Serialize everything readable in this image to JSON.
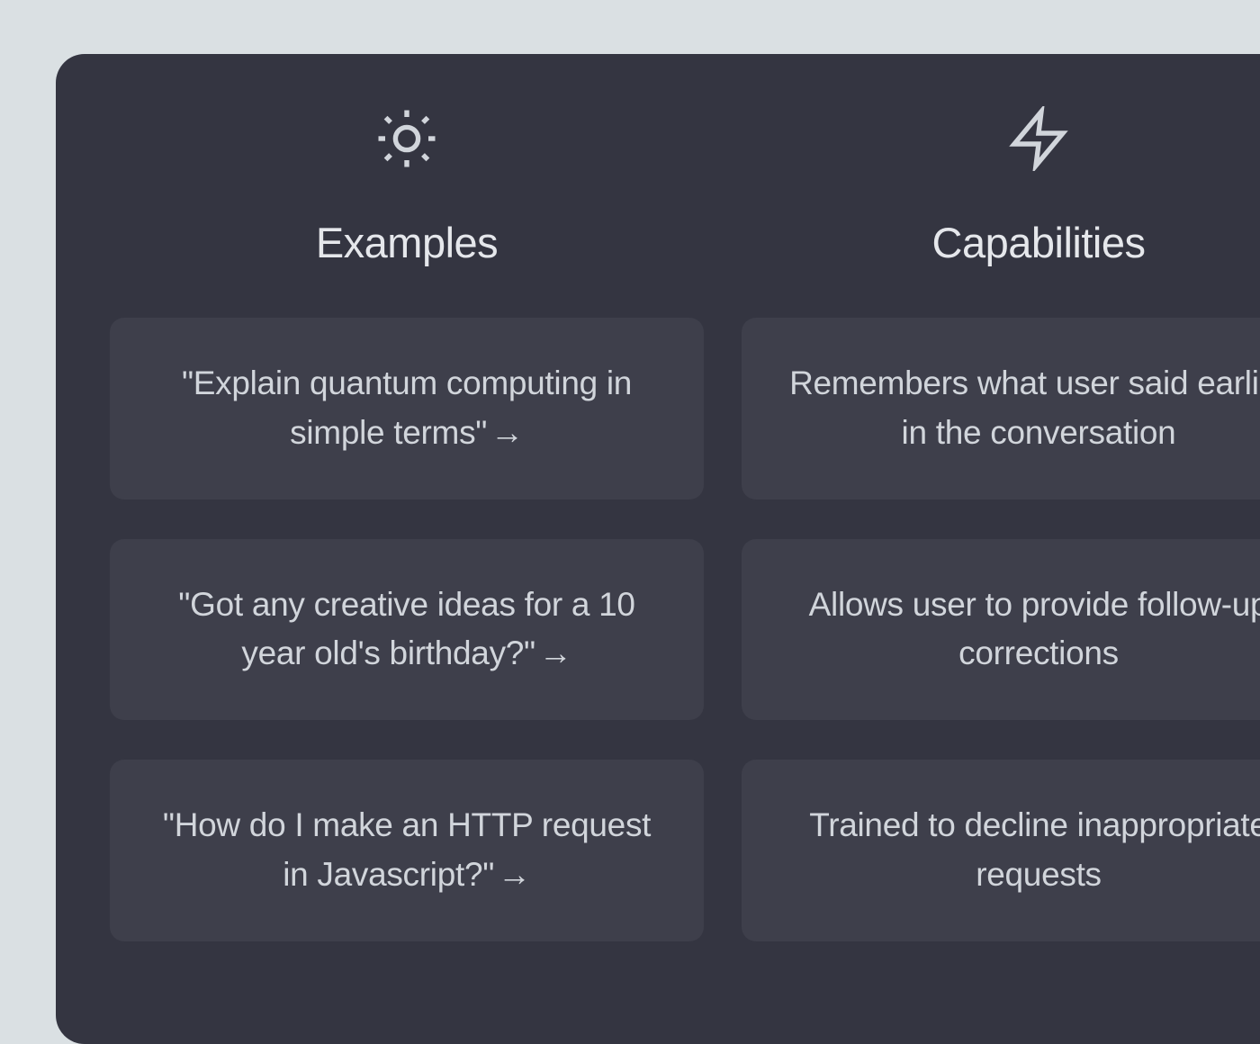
{
  "columns": [
    {
      "title": "Examples",
      "icon": "sun",
      "items": [
        {
          "text": "\"Explain quantum computing in simple terms\"",
          "arrow": true,
          "interactive": true
        },
        {
          "text": "\"Got any creative ideas for a 10 year old's birthday?\"",
          "arrow": true,
          "interactive": true
        },
        {
          "text": "\"How do I make an HTTP request in Javascript?\"",
          "arrow": true,
          "interactive": true
        }
      ]
    },
    {
      "title": "Capabilities",
      "icon": "bolt",
      "items": [
        {
          "text": "Remembers what user said earlier in the conversation",
          "arrow": false,
          "interactive": false
        },
        {
          "text": "Allows user to provide follow-up corrections",
          "arrow": false,
          "interactive": false
        },
        {
          "text": "Trained to decline inappropriate requests",
          "arrow": false,
          "interactive": false
        }
      ]
    }
  ],
  "arrow_glyph": "→"
}
